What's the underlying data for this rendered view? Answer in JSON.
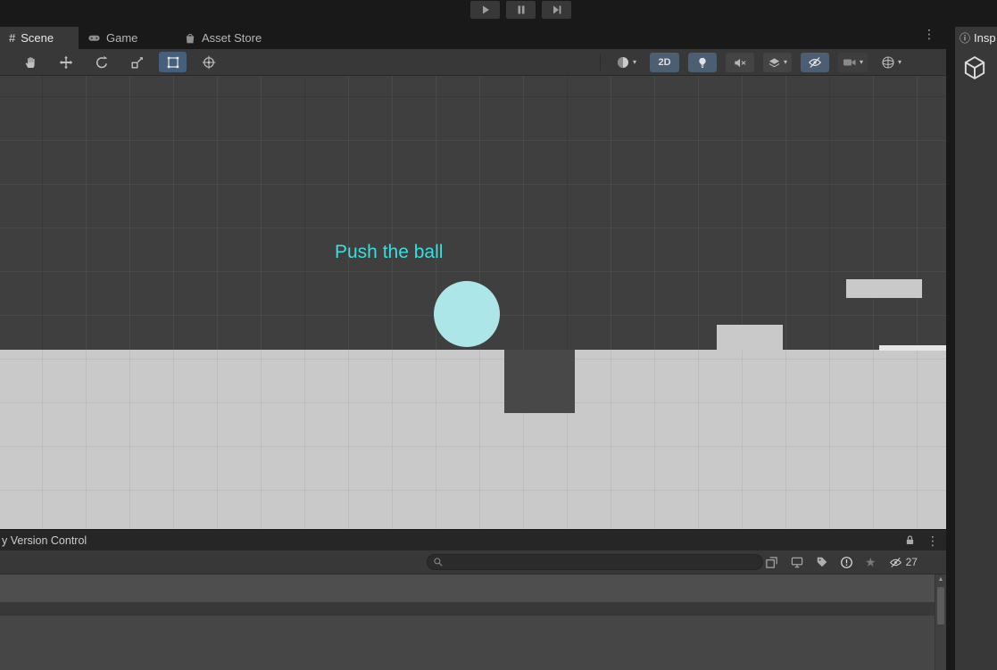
{
  "playbar": {
    "icons": {
      "play": "play-triangle",
      "pause": "pause-bars",
      "step": "step-forward"
    }
  },
  "tabbar": {
    "tabs": [
      {
        "label": "Scene"
      },
      {
        "label": "Game"
      },
      {
        "label": "Asset Store"
      }
    ],
    "menu_icon": "⋮",
    "scene_tab_glyph": "#"
  },
  "scene_toolbar": {
    "tools": [
      "hand",
      "move",
      "rotate",
      "scale",
      "rect",
      "transform"
    ],
    "selected_tool": "rect",
    "mode_2d": "2D",
    "caret": "▾",
    "active_toggle_color": "#4b5e72",
    "selected_tool_color": "#46607c"
  },
  "scene_view": {
    "overlay_text": "Push the ball",
    "overlay_color": "#3adede",
    "ball_color": "#b6f3f5",
    "platform_color": "#c9c9c9",
    "background_color": "#3f3f3f"
  },
  "bottom_panel": {
    "tab_label": "y Version Control",
    "menu_icon": "⋮",
    "search_placeholder": "",
    "hidden_count": "27",
    "star": "★",
    "scroll_up": "▲"
  },
  "inspector": {
    "info_icon": "ⓘ",
    "tab_label": "Insp"
  }
}
